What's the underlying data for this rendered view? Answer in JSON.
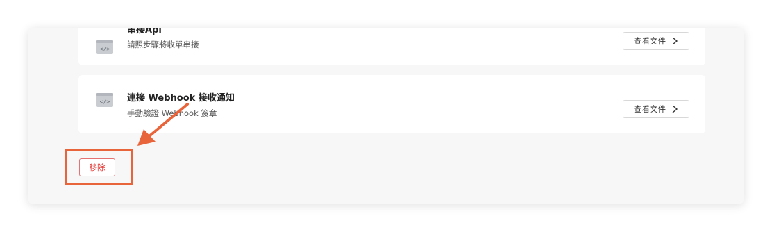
{
  "integrations": [
    {
      "title": "串接Api",
      "description": "請照步驟將收單串接",
      "button_label": "查看文件",
      "icon": "code-icon"
    },
    {
      "title": "連接 Webhook 接收通知",
      "description": "手動驗證 Webhook 簽章",
      "button_label": "查看文件",
      "icon": "code-icon"
    }
  ],
  "remove_button": {
    "label": "移除"
  },
  "annotation": {
    "color": "#e8643a"
  },
  "colors": {
    "accent": "#e53935",
    "panel": "#f7f7f7"
  }
}
